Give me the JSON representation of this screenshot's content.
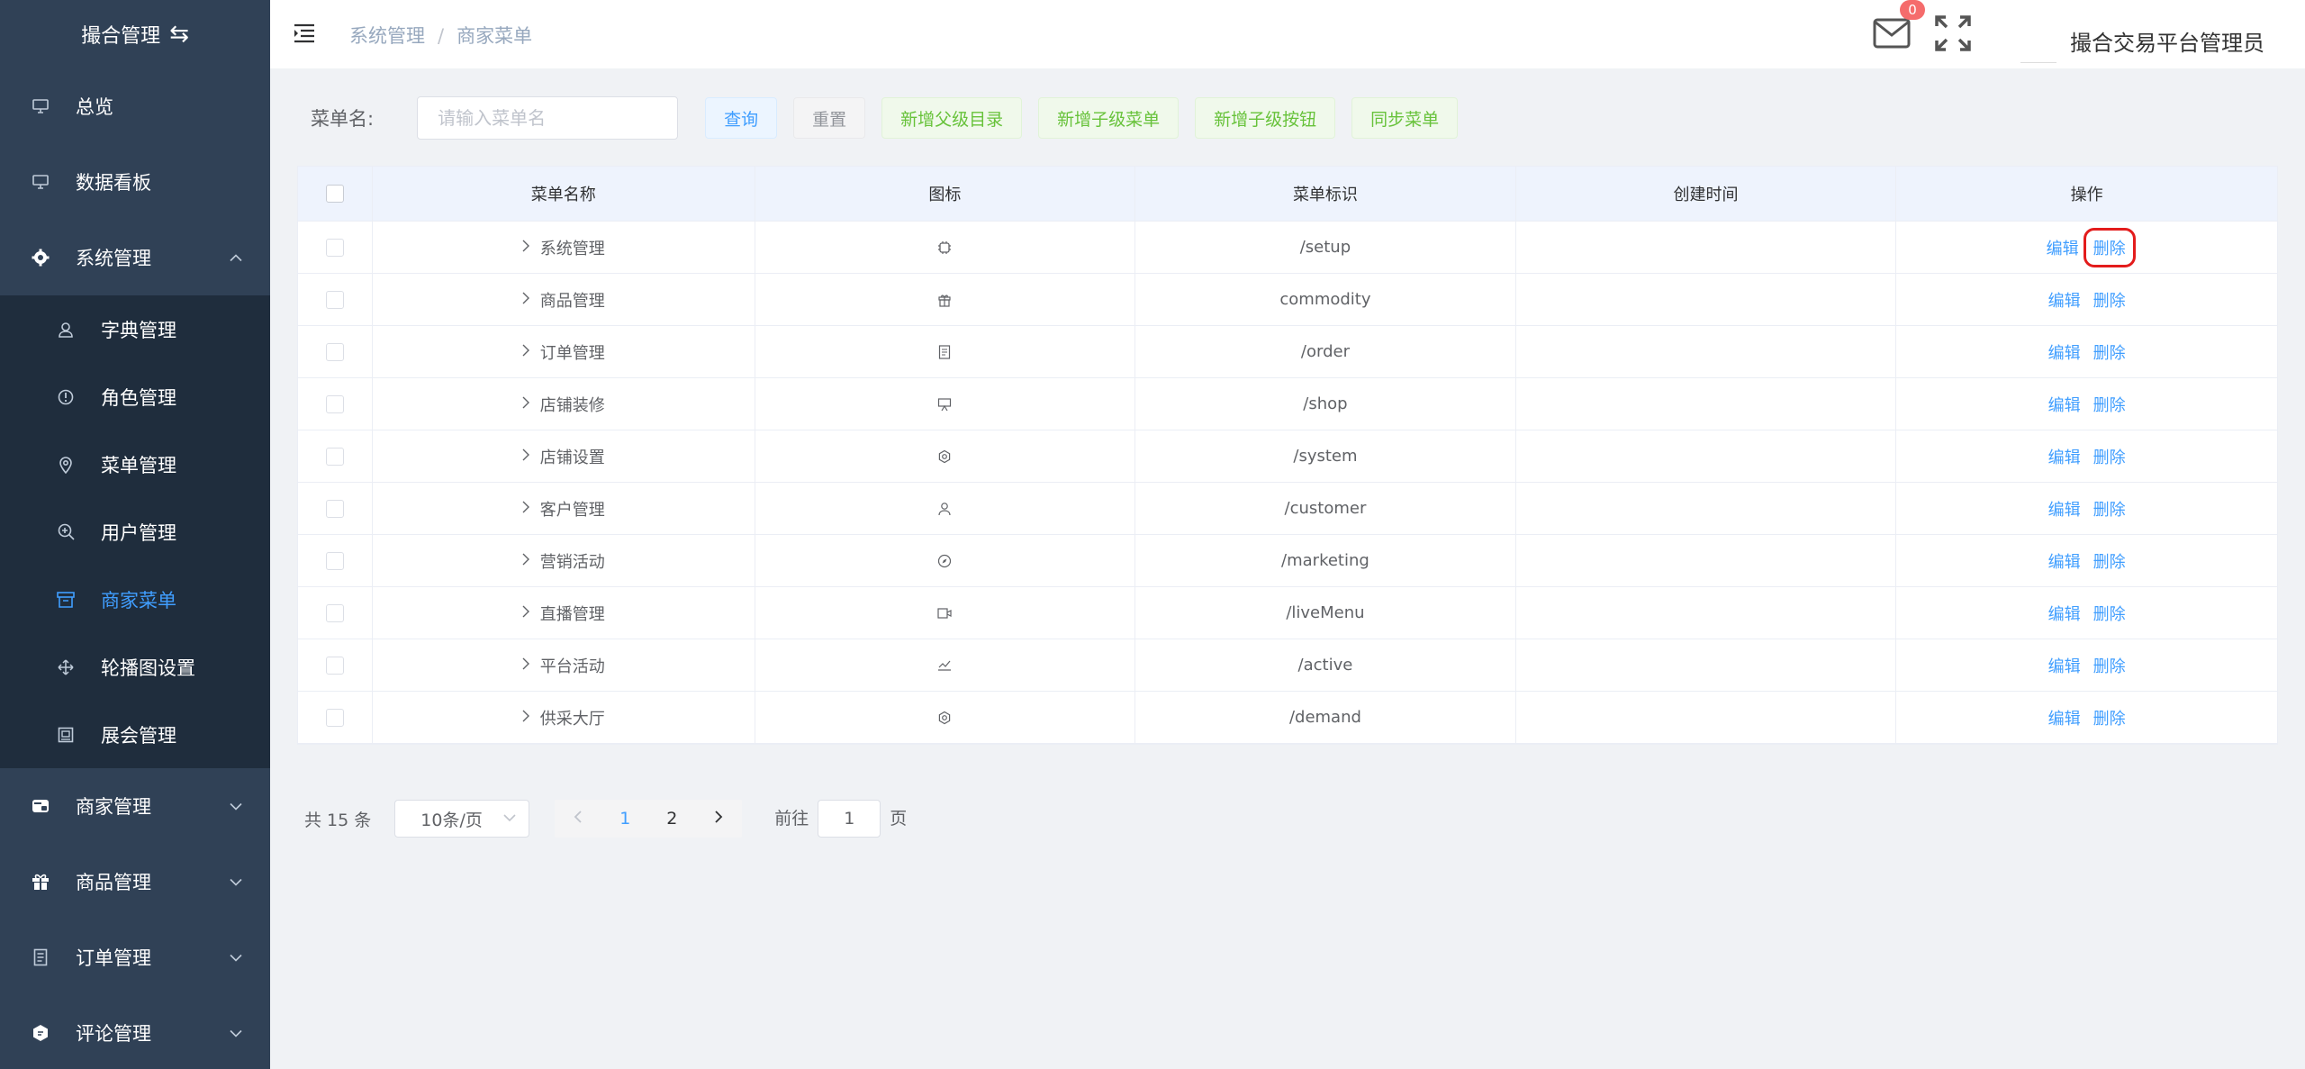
{
  "app": {
    "title": "撮合管理",
    "swap_icon": "swap-icon"
  },
  "sidebar": {
    "items": [
      {
        "label": "总览",
        "icon": "monitor-icon"
      },
      {
        "label": "数据看板",
        "icon": "monitor-icon"
      },
      {
        "label": "系统管理",
        "icon": "gear-icon",
        "expanded": true
      }
    ],
    "sub_items": [
      {
        "label": "字典管理",
        "icon": "user-icon"
      },
      {
        "label": "角色管理",
        "icon": "info-icon"
      },
      {
        "label": "菜单管理",
        "icon": "location-icon"
      },
      {
        "label": "用户管理",
        "icon": "zoom-icon"
      },
      {
        "label": "商家菜单",
        "icon": "box-icon",
        "active": true
      },
      {
        "label": "轮播图设置",
        "icon": "move-icon"
      },
      {
        "label": "展会管理",
        "icon": "picture-icon"
      }
    ],
    "bottom_items": [
      {
        "label": "商家管理",
        "icon": "shop-icon"
      },
      {
        "label": "商品管理",
        "icon": "gift-icon"
      },
      {
        "label": "订单管理",
        "icon": "document-icon"
      },
      {
        "label": "评论管理",
        "icon": "chat-icon"
      }
    ]
  },
  "header": {
    "breadcrumb": [
      "系统管理",
      "商家菜单"
    ],
    "badge_count": "0",
    "username": "撮合交易平台管理员"
  },
  "toolbar": {
    "label": "菜单名:",
    "placeholder": "请输入菜单名",
    "search": "查询",
    "reset": "重置",
    "add_parent": "新增父级目录",
    "add_child_menu": "新增子级菜单",
    "add_child_button": "新增子级按钮",
    "sync": "同步菜单"
  },
  "table": {
    "columns": [
      "菜单名称",
      "图标",
      "菜单标识",
      "创建时间",
      "操作"
    ],
    "edit_label": "编辑",
    "delete_label": "删除",
    "rows": [
      {
        "name": "系统管理",
        "icon": "cpu-icon",
        "key": "/setup",
        "created": ""
      },
      {
        "name": "商品管理",
        "icon": "gift-icon",
        "key": "commodity",
        "created": ""
      },
      {
        "name": "订单管理",
        "icon": "document-icon",
        "key": "/order",
        "created": ""
      },
      {
        "name": "店铺装修",
        "icon": "board-icon",
        "key": "/shop",
        "created": ""
      },
      {
        "name": "店铺设置",
        "icon": "setting-icon",
        "key": "/system",
        "created": ""
      },
      {
        "name": "客户管理",
        "icon": "user-icon",
        "key": "/customer",
        "created": ""
      },
      {
        "name": "营销活动",
        "icon": "compass-icon",
        "key": "/marketing",
        "created": ""
      },
      {
        "name": "直播管理",
        "icon": "video-camera-icon",
        "key": "/liveMenu",
        "created": ""
      },
      {
        "name": "平台活动",
        "icon": "data-line-icon",
        "key": "/active",
        "created": ""
      },
      {
        "name": "供采大厅",
        "icon": "setting-icon",
        "key": "/demand",
        "created": ""
      }
    ]
  },
  "pagination": {
    "total": "共 15 条",
    "page_size": "10条/页",
    "pages": [
      "1",
      "2"
    ],
    "goto_prefix": "前往",
    "goto_value": "1",
    "goto_suffix": "页"
  }
}
